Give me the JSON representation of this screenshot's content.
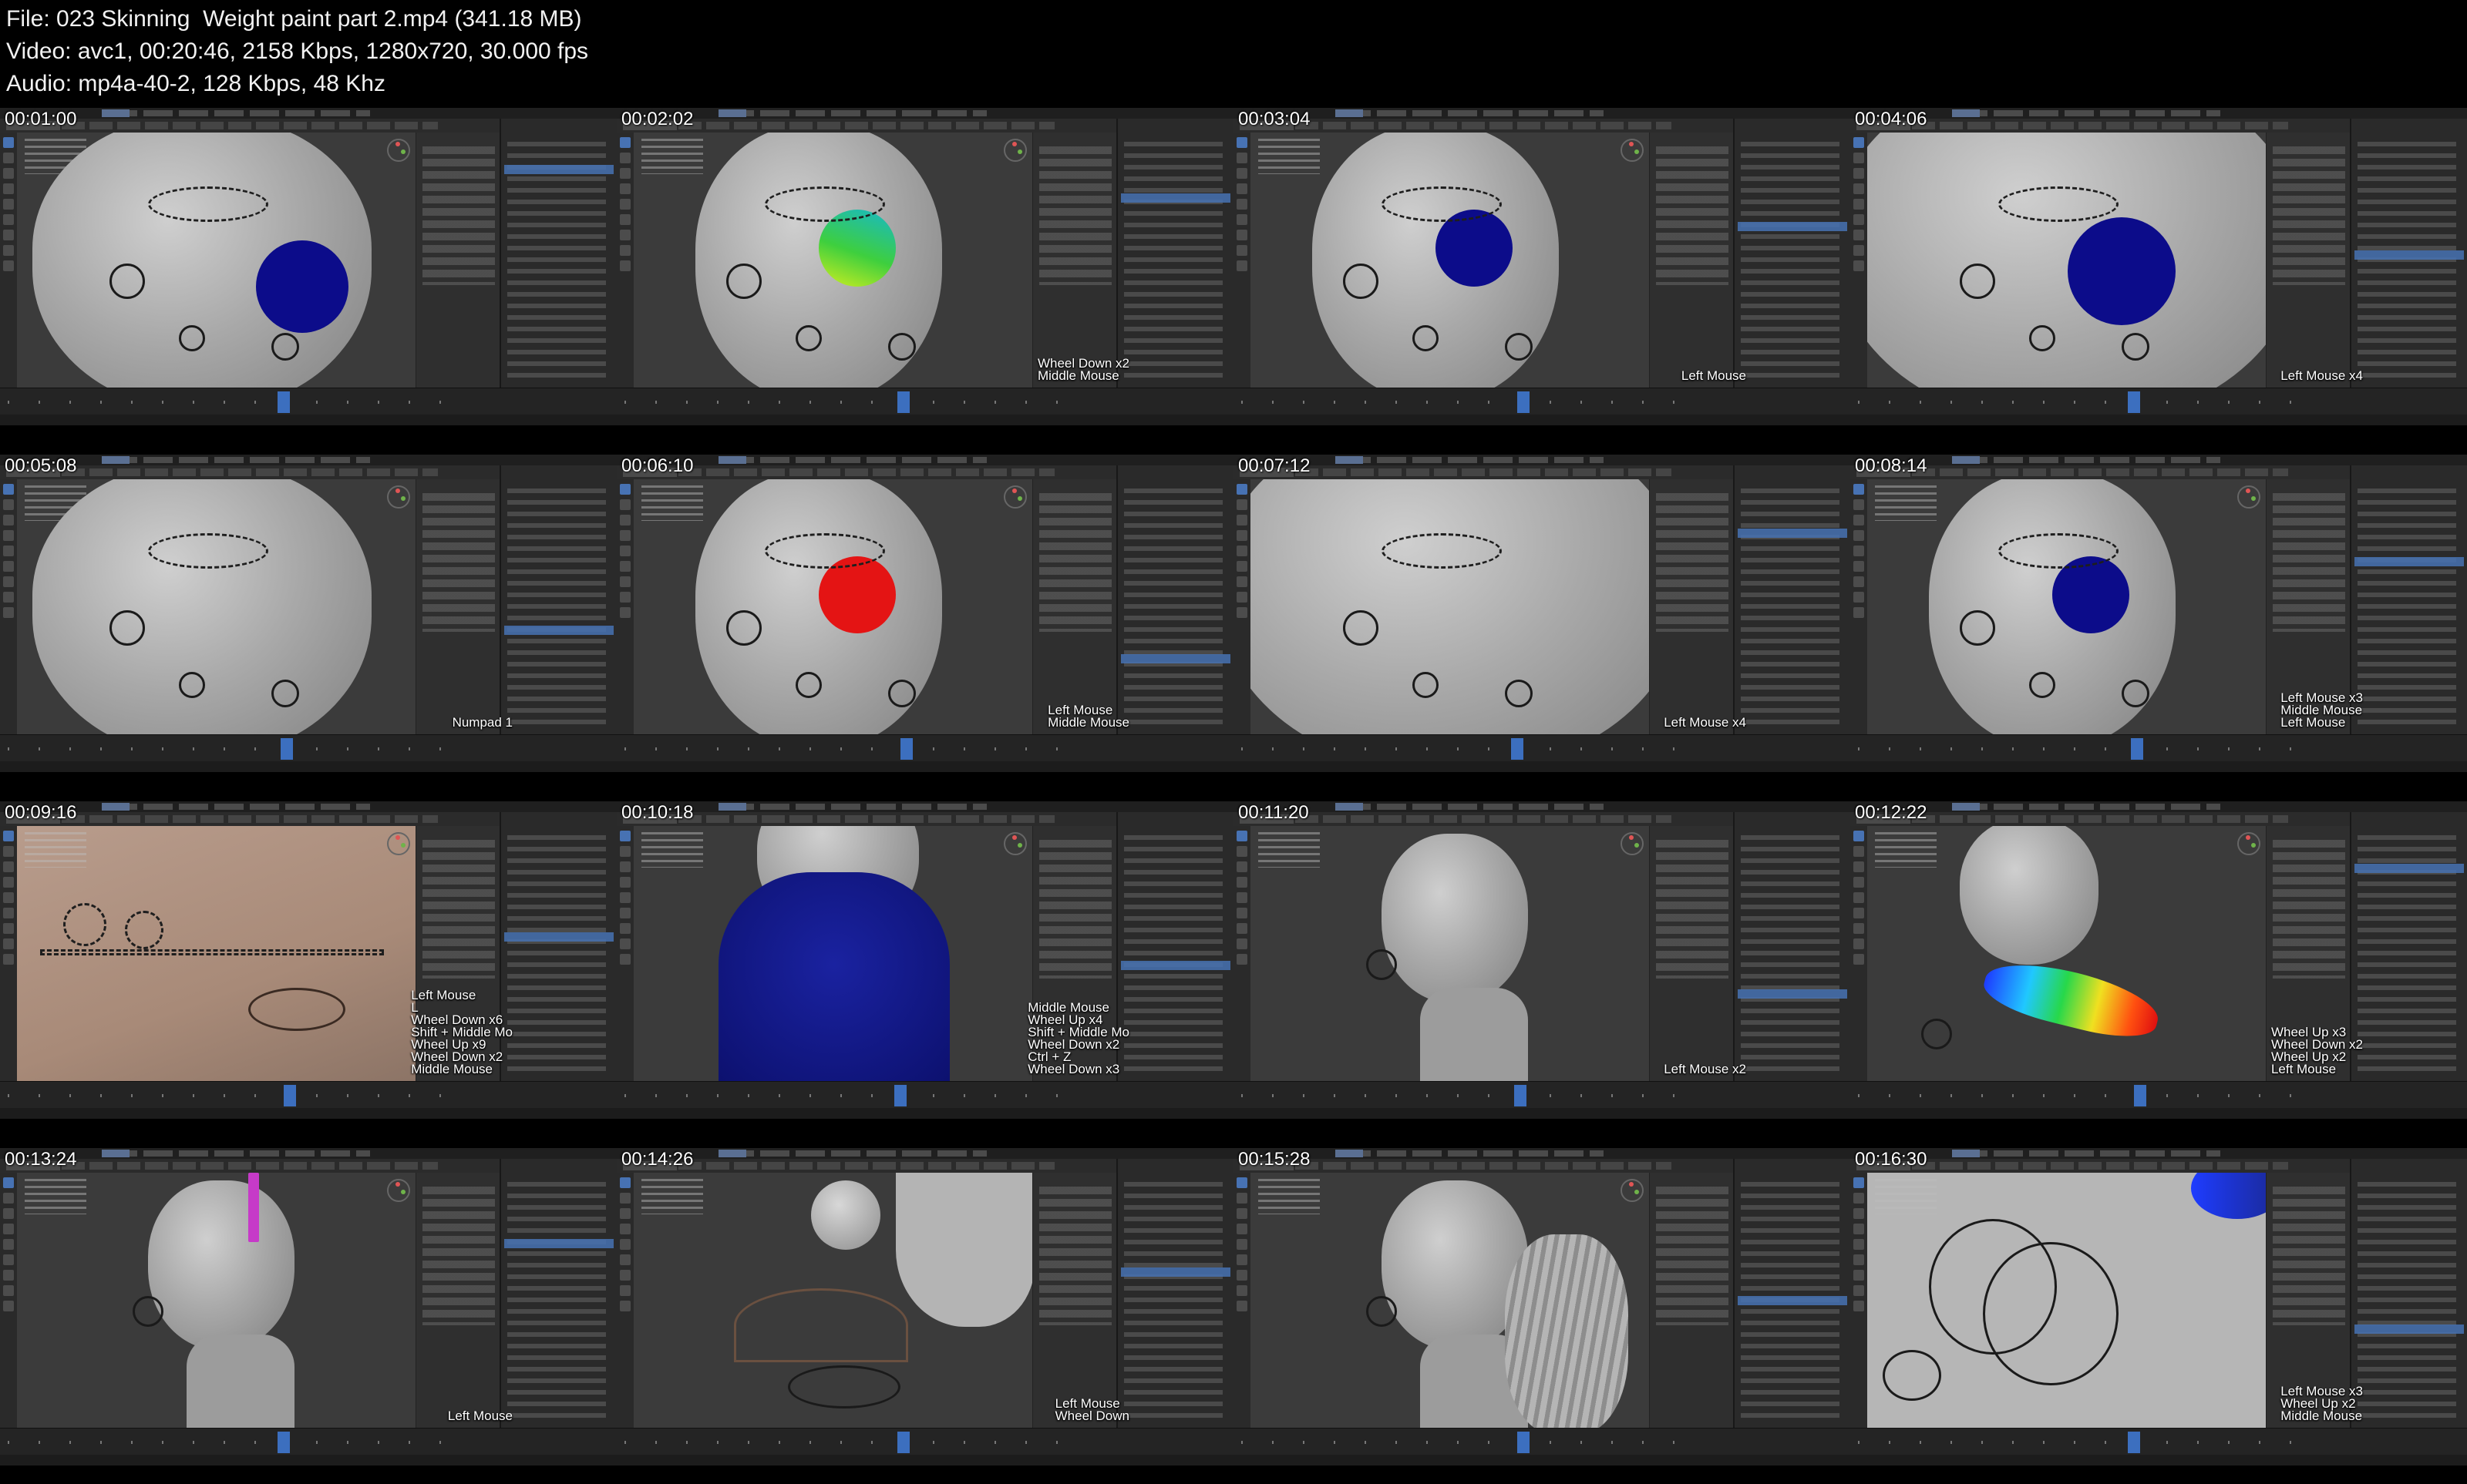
{
  "header": {
    "file_line": "File: 023 Skinning  Weight paint part 2.mp4 (341.18 MB)",
    "video_line": "Video: avc1, 00:20:46, 2158 Kbps, 1280x720, 30.000 fps",
    "audio_line": "Audio: mp4a-40-2, 128 Kbps, 48 Khz"
  },
  "thumbnails": [
    {
      "timestamp": "00:01:00",
      "keys": [],
      "scene": "face-front",
      "sphere_color": "#0c0c8a"
    },
    {
      "timestamp": "00:02:02",
      "keys": [
        "Wheel Down x2",
        "Middle Mouse"
      ],
      "scene": "head-side",
      "sphere_color": "#3ecf3e"
    },
    {
      "timestamp": "00:03:04",
      "keys": [
        "Left Mouse"
      ],
      "scene": "head-three-quarter",
      "sphere_color": "#0c0c8a"
    },
    {
      "timestamp": "00:04:06",
      "keys": [
        "Left Mouse x4"
      ],
      "scene": "face-close",
      "sphere_color": "#0c0c8a"
    },
    {
      "timestamp": "00:05:08",
      "keys": [
        "Numpad 1"
      ],
      "scene": "face-front",
      "sphere_color": ""
    },
    {
      "timestamp": "00:06:10",
      "keys": [
        "Left Mouse",
        "Middle Mouse"
      ],
      "scene": "head-side",
      "sphere_color": "#e41414"
    },
    {
      "timestamp": "00:07:12",
      "keys": [
        "Left Mouse x4"
      ],
      "scene": "face-close",
      "sphere_color": ""
    },
    {
      "timestamp": "00:08:14",
      "keys": [
        "Left Mouse x3",
        "Middle Mouse",
        "Left Mouse"
      ],
      "scene": "head-three-quarter",
      "sphere_color": "#0c0c8a"
    },
    {
      "timestamp": "00:09:16",
      "keys": [
        "Left Mouse",
        "L",
        "Wheel Down x6",
        "Shift + Middle Mo",
        "Wheel Up x9",
        "Wheel Down x2",
        "Middle Mouse"
      ],
      "scene": "tan-surface",
      "sphere_color": ""
    },
    {
      "timestamp": "00:10:18",
      "keys": [
        "Middle Mouse",
        "Wheel Up x4",
        "Shift + Middle Mo",
        "Wheel Down x2",
        "Ctrl + Z",
        "Wheel Down x3"
      ],
      "scene": "blue-neck",
      "sphere_color": ""
    },
    {
      "timestamp": "00:11:20",
      "keys": [
        "Left Mouse x2"
      ],
      "scene": "face-profile",
      "sphere_color": ""
    },
    {
      "timestamp": "00:12:22",
      "keys": [
        "Wheel Up x3",
        "Wheel Down x2",
        "Wheel Up x2",
        "Left Mouse"
      ],
      "scene": "weight-arc",
      "sphere_color": ""
    },
    {
      "timestamp": "00:13:24",
      "keys": [
        "Left Mouse"
      ],
      "scene": "bust-side",
      "sphere_color": ""
    },
    {
      "timestamp": "00:14:26",
      "keys": [
        "Left Mouse",
        "Wheel Down"
      ],
      "scene": "curved-bone",
      "sphere_color": ""
    },
    {
      "timestamp": "00:15:28",
      "keys": [],
      "scene": "hair-profile",
      "sphere_color": ""
    },
    {
      "timestamp": "00:16:30",
      "keys": [
        "Left Mouse x3",
        "Wheel Up x2",
        "Middle Mouse"
      ],
      "scene": "rings-close",
      "sphere_color": ""
    }
  ]
}
